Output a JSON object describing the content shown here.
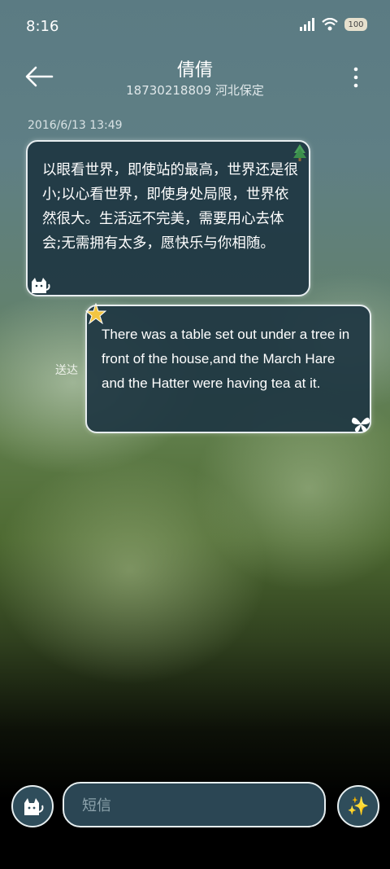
{
  "status_bar": {
    "time": "8:16",
    "battery": "100"
  },
  "header": {
    "title": "倩倩",
    "subtitle": "18730218809 河北保定"
  },
  "conversation": {
    "timestamp": "2016/6/13 13:49",
    "incoming_text": "以眼看世界，即使站的最高，世界还是很小;以心看世界，即使身处局限，世界依然很大。生活远不完美，需要用心去体会;无需拥有太多，愿快乐与你相随。",
    "outgoing_text": "There was a table set out under a tree in front of the house,and the March Hare and the Hatter were having tea at it.",
    "sent_status": "送达"
  },
  "composer": {
    "placeholder": "短信",
    "sparkle": "✨"
  },
  "icons": [
    "back-arrow-icon",
    "more-vert-icon",
    "signal-icon",
    "wifi-icon",
    "battery-icon",
    "cat-icon",
    "tree-icon",
    "star-icon",
    "butterfly-icon",
    "sparkle-icon"
  ]
}
